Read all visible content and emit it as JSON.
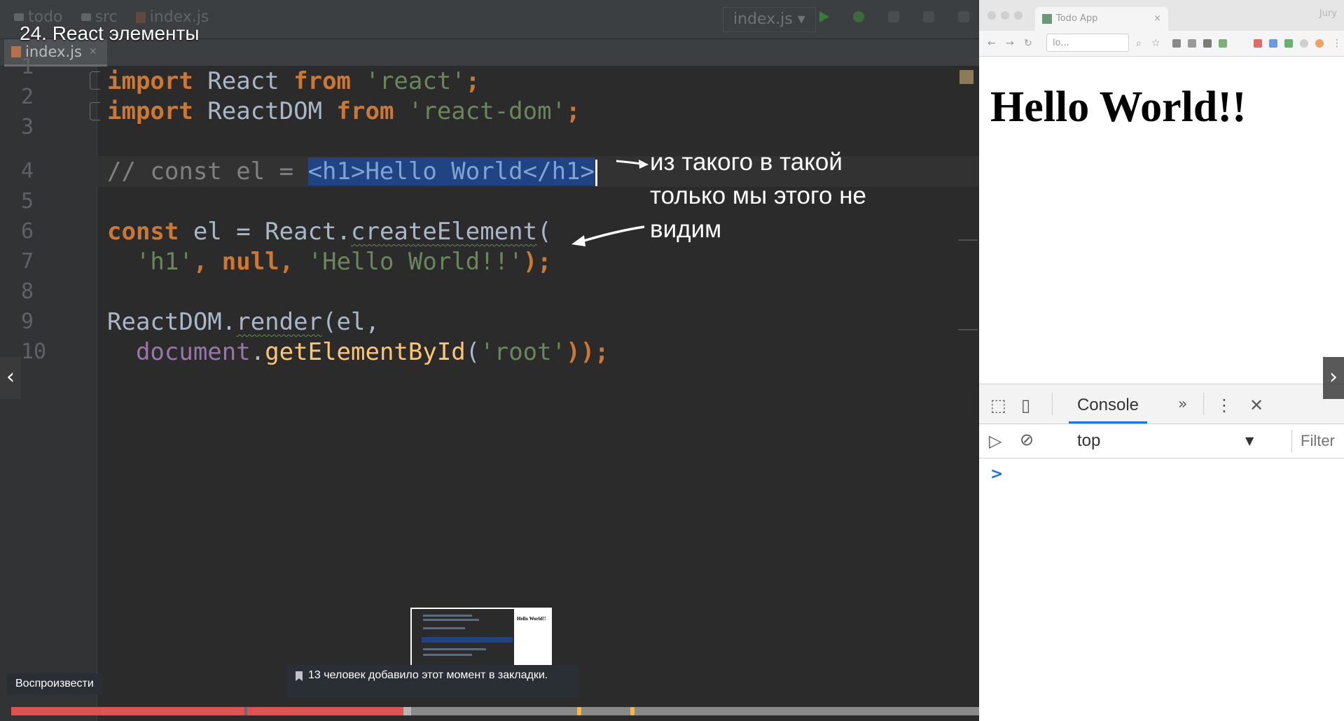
{
  "video": {
    "title": "24. React элементы",
    "play_tooltip": "Воспроизвести",
    "bookmark_tooltip": "13 человек добавило этот момент в закладки.",
    "progress_fraction": 0.405,
    "buffered_fraction": 0.413,
    "bookmark_markers_fraction": [
      0.585,
      0.64
    ],
    "chapter_gap_fraction": 0.241
  },
  "ide": {
    "breadcrumbs": [
      "todo",
      "src",
      "index.js"
    ],
    "run_config": "index.js",
    "file_tab": "index.js",
    "line_numbers": [
      "1",
      "2",
      "3",
      "4",
      "5",
      "6",
      "7",
      "8",
      "9",
      "10"
    ]
  },
  "code": {
    "l1": {
      "kw1": "import",
      "id": " React ",
      "kw2": "from",
      "str": " 'react'",
      "punct": ";"
    },
    "l2": {
      "kw1": "import",
      "id": " ReactDOM ",
      "kw2": "from",
      "str": " 'react-dom'",
      "punct": ";"
    },
    "l4": {
      "comment": "// const el = ",
      "selected": "<h1>Hello World</h1>"
    },
    "l6": {
      "kw": "const",
      "rest": " el = React.",
      "method": "createElement",
      "paren": "("
    },
    "l7": {
      "indent": "  ",
      "str1": "'h1'",
      "comma1": ", ",
      "kw": "null",
      "comma2": ", ",
      "str2": "'Hello World!!'",
      "end": ");"
    },
    "l9": {
      "obj": "ReactDOM.",
      "method": "render",
      "rest": "(el,"
    },
    "l10": {
      "indent": "  ",
      "glob": "document",
      "dot": ".",
      "method": "getElementById",
      "open": "(",
      "str": "'root'",
      "end": "));"
    }
  },
  "annotation": {
    "line1": "из такого в такой",
    "line2": "только мы этого не",
    "line3": "видим"
  },
  "browser": {
    "tab_title": "Todo App",
    "profile": "Jury",
    "url": "lo...",
    "page_heading": "Hello World!!",
    "devtools": {
      "active_tab": "Console",
      "context": "top",
      "filter_placeholder": "Filter",
      "prompt": ">"
    }
  }
}
